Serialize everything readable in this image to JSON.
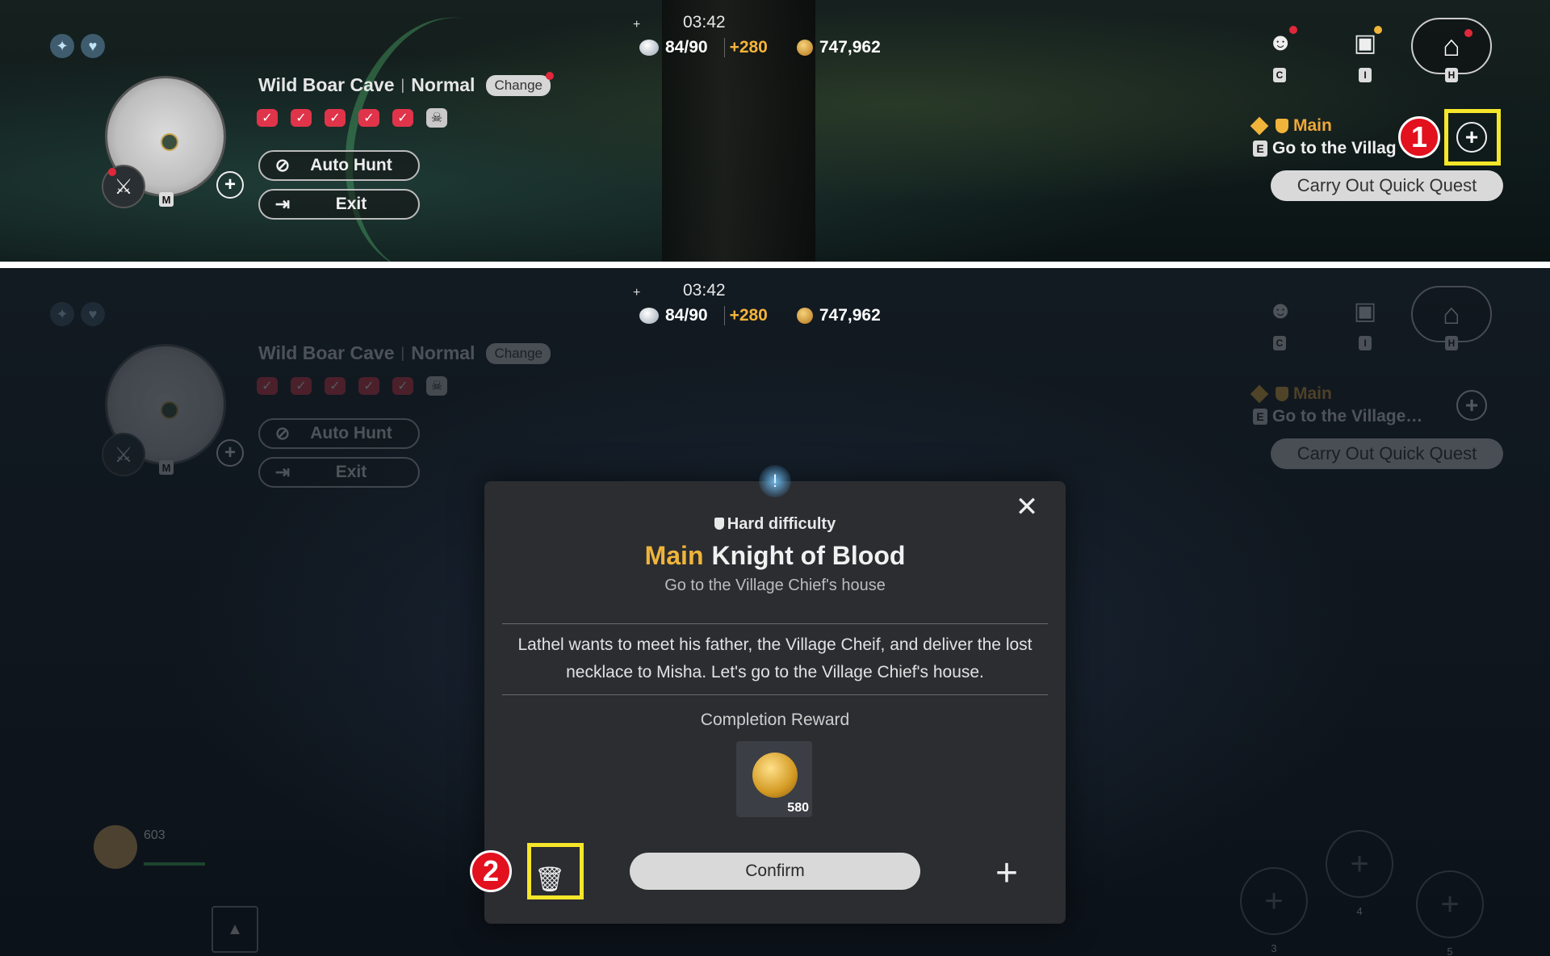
{
  "hud": {
    "timer": "03:42",
    "stamina": "84/90",
    "stamina_bonus": "+280",
    "gold": "747,962",
    "dungeon_name": "Wild Boar Cave",
    "dungeon_difficulty": "Normal",
    "change_label": "Change",
    "auto_hunt_label": "Auto Hunt",
    "exit_label": "Exit",
    "map_key": "M",
    "icon_keys": [
      "C",
      "I",
      "H"
    ],
    "quest_type": "Main",
    "quest_key": "E",
    "quest_text_top": "Go to the Villag",
    "quest_text_bottom": "Go to the Village…",
    "quick_quest_label": "Carry Out Quick Quest"
  },
  "modal": {
    "difficulty": "Hard difficulty",
    "quest_tag": "Main",
    "quest_name": "Knight of Blood",
    "subtitle": "Go to the Village Chief's house",
    "description": "Lathel wants to meet his father, the Village Cheif, and deliver the lost necklace to Misha. Let's go to the Village Chief's house.",
    "reward_label": "Completion Reward",
    "reward_count": "580",
    "confirm_label": "Confirm"
  },
  "annotations": {
    "step1": "1",
    "step2": "2"
  },
  "bottom": {
    "party_level": "603",
    "skill_keys": [
      "3",
      "4",
      "5"
    ]
  },
  "colors": {
    "highlight": "#f5e62a",
    "annotation_red": "#e3101e",
    "quest_gold": "#f0b43a"
  }
}
